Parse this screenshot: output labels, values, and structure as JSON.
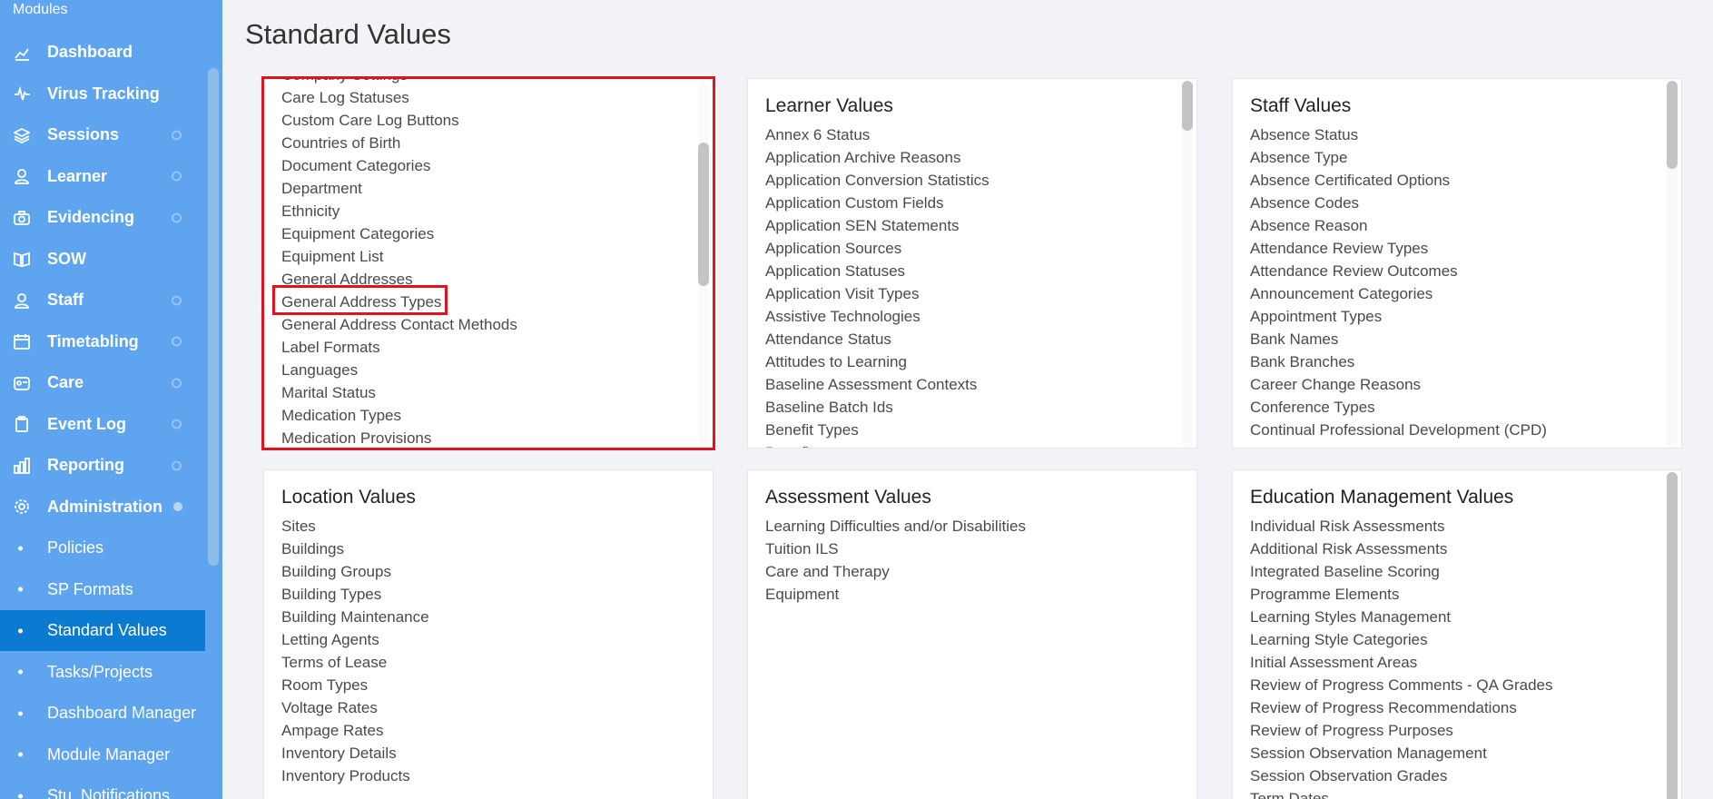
{
  "sidebar": {
    "title": "Modules",
    "items": [
      {
        "label": "Dashboard",
        "icon": "chart-line-icon",
        "indicator": "none"
      },
      {
        "label": "Virus Tracking",
        "icon": "pulse-icon",
        "indicator": "none"
      },
      {
        "label": "Sessions",
        "icon": "layers-icon",
        "indicator": "ring"
      },
      {
        "label": "Learner",
        "icon": "learner-icon",
        "indicator": "ring"
      },
      {
        "label": "Evidencing",
        "icon": "camera-icon",
        "indicator": "ring"
      },
      {
        "label": "SOW",
        "icon": "book-icon",
        "indicator": "none"
      },
      {
        "label": "Staff",
        "icon": "staff-icon",
        "indicator": "ring"
      },
      {
        "label": "Timetabling",
        "icon": "calendar-icon",
        "indicator": "ring"
      },
      {
        "label": "Care",
        "icon": "care-icon",
        "indicator": "ring"
      },
      {
        "label": "Event Log",
        "icon": "clipboard-icon",
        "indicator": "ring"
      },
      {
        "label": "Reporting",
        "icon": "report-icon",
        "indicator": "ring"
      },
      {
        "label": "Administration",
        "icon": "gear-icon",
        "indicator": "filled"
      }
    ],
    "sub_items": [
      {
        "label": "Policies",
        "active": false
      },
      {
        "label": "SP Formats",
        "active": false
      },
      {
        "label": "Standard Values",
        "active": true
      },
      {
        "label": "Tasks/Projects",
        "active": false
      },
      {
        "label": "Dashboard Manager",
        "active": false
      },
      {
        "label": "Module Manager",
        "active": false
      },
      {
        "label": "Stu. Notifications",
        "active": false
      }
    ]
  },
  "page": {
    "title": "Standard Values"
  },
  "cards": {
    "general": {
      "title": "",
      "partial_top_item": "Company Settings",
      "items": [
        "Care Log Statuses",
        "Custom Care Log Buttons",
        "Countries of Birth",
        "Document Categories",
        "Department",
        "Ethnicity",
        "Equipment Categories",
        "Equipment List",
        "General Addresses",
        "General Address Types",
        "General Address Contact Methods",
        "Label Formats",
        "Languages",
        "Marital Status",
        "Medication Types",
        "Medication Provisions"
      ],
      "highlighted_item": "General Address Types"
    },
    "learner": {
      "title": "Learner Values",
      "items": [
        "Annex 6 Status",
        "Application Archive Reasons",
        "Application Conversion Statistics",
        "Application Custom Fields",
        "Application SEN Statements",
        "Application Sources",
        "Application Statuses",
        "Application Visit Types",
        "Assistive Technologies",
        "Attendance Status",
        "Attitudes to Learning",
        "Baseline Assessment Contexts",
        "Baseline Batch Ids",
        "Benefit Types",
        "Benefits"
      ]
    },
    "staff": {
      "title": "Staff Values",
      "items": [
        "Absence Status",
        "Absence Type",
        "Absence Certificated Options",
        "Absence Codes",
        "Absence Reason",
        "Attendance Review Types",
        "Attendance Review Outcomes",
        "Announcement Categories",
        "Appointment Types",
        "Bank Names",
        "Bank Branches",
        "Career Change Reasons",
        "Conference Types",
        "Continual Professional Development (CPD)"
      ]
    },
    "location": {
      "title": "Location Values",
      "items": [
        "Sites",
        "Buildings",
        "Building Groups",
        "Building Types",
        "Building Maintenance",
        "Letting Agents",
        "Terms of Lease",
        "Room Types",
        "Voltage Rates",
        "Ampage Rates",
        "Inventory Details",
        "Inventory Products"
      ]
    },
    "assessment": {
      "title": "Assessment Values",
      "items": [
        "Learning Difficulties and/or Disabilities",
        "Tuition ILS",
        "Care and Therapy",
        "Equipment"
      ]
    },
    "education": {
      "title": "Education Management Values",
      "items": [
        "Individual Risk Assessments",
        "Additional Risk Assessments",
        "Integrated Baseline Scoring",
        "Programme Elements",
        "Learning Styles Management",
        "Learning Style Categories",
        "Initial Assessment Areas",
        "Review of Progress Comments - QA Grades",
        "Review of Progress Recommendations",
        "Review of Progress Purposes",
        "Session Observation Management",
        "Session Observation Grades",
        "Term Dates"
      ]
    }
  },
  "colors": {
    "sidebar_bg": "#5fa4ef",
    "active_bg": "#0a7bd0",
    "highlight": "#e0141e"
  }
}
